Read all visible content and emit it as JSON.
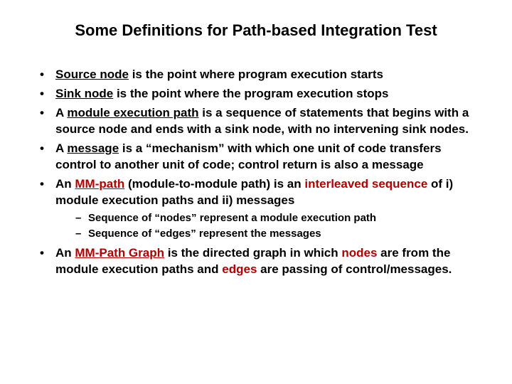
{
  "title": "Some Definitions for Path-based Integration Test",
  "b1": {
    "term": "Source node",
    "rest": " is the point where program execution starts"
  },
  "b2": {
    "term": "Sink node",
    "rest": " is the point where the program execution stops"
  },
  "b3": {
    "pre": "A ",
    "term": "module execution path",
    "rest": " is a sequence of statements that begins with a source node and ends with a sink node, with no intervening sink nodes."
  },
  "b4": {
    "pre": "A ",
    "term": "message",
    "rest": " is a “mechanism” with which one unit of code transfers control to another unit of code; control return is also a message"
  },
  "b5": {
    "pre": "An ",
    "term": "MM-path",
    "mid1": " (module-to-module path) is an ",
    "hi1": "interleaved sequence",
    "rest": " of i) module execution paths and ii) messages"
  },
  "s1": "Sequence of “nodes” represent a module execution path",
  "s2": "Sequence of “edges” represent the messages",
  "b6": {
    "pre": "An ",
    "term": "MM-Path Graph",
    "mid1": " is the directed graph in which ",
    "hi1": "nodes",
    "mid2": " are from the module execution paths and ",
    "hi2": "edges",
    "rest": " are passing of control/messages."
  }
}
